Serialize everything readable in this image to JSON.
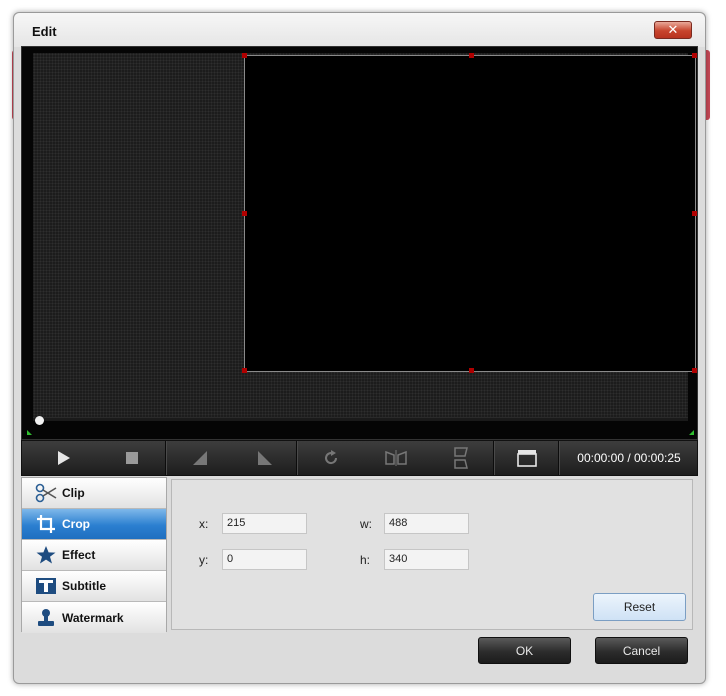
{
  "window": {
    "title": "Edit",
    "close_label": "✕"
  },
  "player": {
    "time": "00:00:00 / 00:00:25"
  },
  "tabs": [
    {
      "label": "Clip",
      "icon": "scissors-icon",
      "active": false
    },
    {
      "label": "Crop",
      "icon": "crop-icon",
      "active": true
    },
    {
      "label": "Effect",
      "icon": "star-icon",
      "active": false
    },
    {
      "label": "Subtitle",
      "icon": "subtitle-icon",
      "active": false
    },
    {
      "label": "Watermark",
      "icon": "stamp-icon",
      "active": false
    }
  ],
  "crop": {
    "x_label": "x:",
    "x_value": "215",
    "y_label": "y:",
    "y_value": "0",
    "w_label": "w:",
    "w_value": "488",
    "h_label": "h:",
    "h_value": "340",
    "reset_label": "Reset"
  },
  "buttons": {
    "ok_label": "OK",
    "cancel_label": "Cancel"
  },
  "colors": {
    "active_tab": "#2b7fd0",
    "crop_handle": "#b00000",
    "range_marker": "#2fbf2f"
  }
}
